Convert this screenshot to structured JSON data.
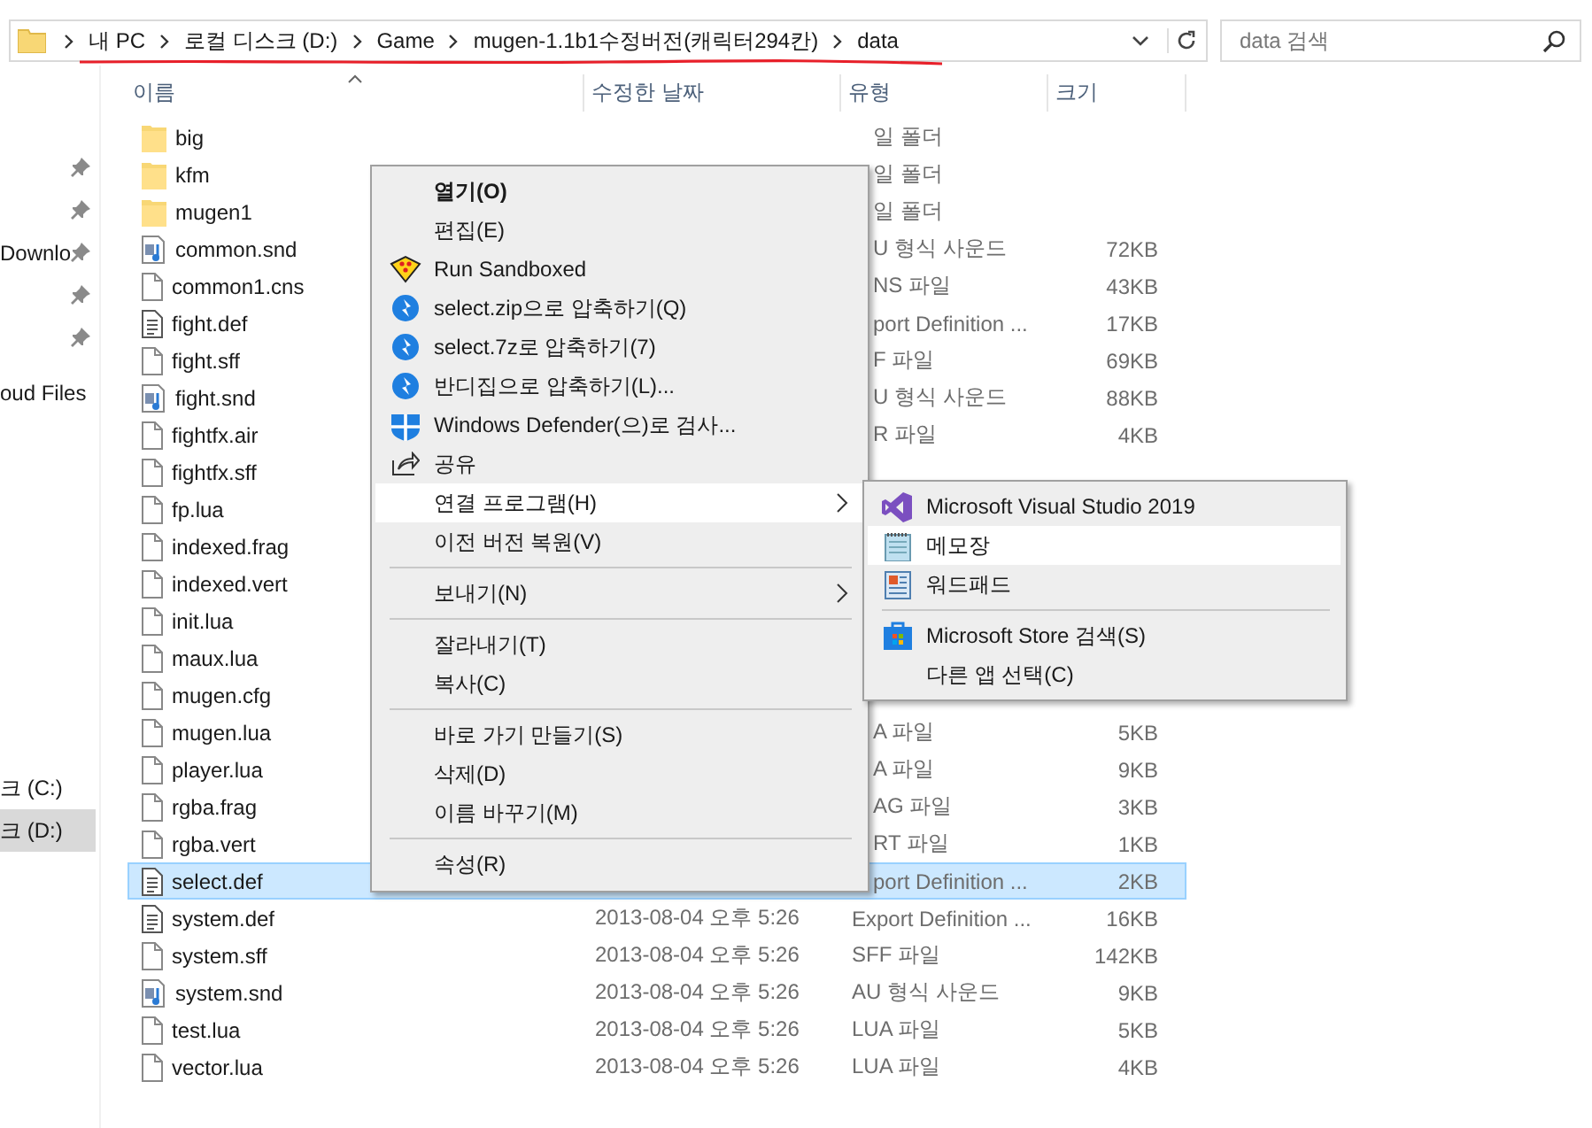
{
  "address_bar": {
    "crumbs": [
      "내 PC",
      "로컬 디스크 (D:)",
      "Game",
      "mugen-1.1b1수정버전(캐릭터294칸)",
      "data"
    ]
  },
  "search": {
    "placeholder": "data 검색"
  },
  "sidebar": {
    "sections": [
      {
        "items": [
          {
            "pinned": true,
            "selected": false
          },
          {
            "pinned": true,
            "selected": false
          },
          {
            "label": "Downlo",
            "pinned": true,
            "selected": false
          },
          {
            "pinned": true,
            "selected": false
          },
          {
            "pinned": true,
            "selected": false
          }
        ]
      },
      {
        "items": [
          {
            "label": "oud Files",
            "pinned": false,
            "selected": false
          }
        ]
      },
      {
        "items": [
          {
            "label": "크 (C:)",
            "pinned": false,
            "selected": false
          },
          {
            "label": "크 (D:)",
            "pinned": false,
            "selected": true
          }
        ]
      }
    ]
  },
  "columns": [
    "이름",
    "수정한 날짜",
    "유형",
    "크기"
  ],
  "files": [
    {
      "name": "big",
      "kind": "folder",
      "type": "일 폴더",
      "type_cut": true,
      "selected": false
    },
    {
      "name": "kfm",
      "kind": "folder",
      "type": "일 폴더",
      "type_cut": true,
      "selected": false
    },
    {
      "name": "mugen1",
      "kind": "folder",
      "type": "일 폴더",
      "type_cut": true,
      "selected": false
    },
    {
      "name": "common.snd",
      "kind": "audio",
      "type": "U 형식 사운드",
      "type_cut": true,
      "size": "72KB",
      "selected": false
    },
    {
      "name": "common1.cns",
      "kind": "file",
      "type": "NS 파일",
      "type_cut": true,
      "size": "43KB",
      "selected": false
    },
    {
      "name": "fight.def",
      "kind": "text",
      "type": "port Definition ...",
      "type_cut": true,
      "size": "17KB",
      "selected": false
    },
    {
      "name": "fight.sff",
      "kind": "file",
      "type": "F 파일",
      "type_cut": true,
      "size": "69KB",
      "selected": false
    },
    {
      "name": "fight.snd",
      "kind": "audio",
      "type": "U 형식 사운드",
      "type_cut": true,
      "size": "88KB",
      "selected": false
    },
    {
      "name": "fightfx.air",
      "kind": "file",
      "type": "R 파일",
      "type_cut": true,
      "size": "4KB",
      "selected": false
    },
    {
      "name": "fightfx.sff",
      "kind": "file",
      "selected": false
    },
    {
      "name": "fp.lua",
      "kind": "file",
      "selected": false
    },
    {
      "name": "indexed.frag",
      "kind": "file",
      "selected": false
    },
    {
      "name": "indexed.vert",
      "kind": "file",
      "selected": false
    },
    {
      "name": "init.lua",
      "kind": "file",
      "selected": false
    },
    {
      "name": "maux.lua",
      "kind": "file",
      "selected": false
    },
    {
      "name": "mugen.cfg",
      "kind": "file",
      "selected": false
    },
    {
      "name": "mugen.lua",
      "kind": "file",
      "type": "A 파일",
      "type_cut": true,
      "size": "5KB",
      "selected": false
    },
    {
      "name": "player.lua",
      "kind": "file",
      "type": "A 파일",
      "type_cut": true,
      "size": "9KB",
      "selected": false
    },
    {
      "name": "rgba.frag",
      "kind": "file",
      "type": "AG 파일",
      "type_cut": true,
      "size": "3KB",
      "selected": false
    },
    {
      "name": "rgba.vert",
      "kind": "file",
      "type": "RT 파일",
      "type_cut": true,
      "size": "1KB",
      "selected": false
    },
    {
      "name": "select.def",
      "kind": "text",
      "type": "port Definition ...",
      "type_cut": true,
      "size": "2KB",
      "selected": true
    },
    {
      "name": "system.def",
      "kind": "text",
      "date": "2013-08-04 오후 5:26",
      "type": "Export Definition ...",
      "type_cut": false,
      "size": "16KB",
      "selected": false
    },
    {
      "name": "system.sff",
      "kind": "file",
      "date": "2013-08-04 오후 5:26",
      "type": "SFF 파일",
      "type_cut": false,
      "size": "142KB",
      "selected": false
    },
    {
      "name": "system.snd",
      "kind": "audio",
      "date": "2013-08-04 오후 5:26",
      "type": "AU 형식 사운드",
      "type_cut": false,
      "size": "9KB",
      "selected": false
    },
    {
      "name": "test.lua",
      "kind": "file",
      "date": "2013-08-04 오후 5:26",
      "type": "LUA 파일",
      "type_cut": false,
      "size": "5KB",
      "selected": false
    },
    {
      "name": "vector.lua",
      "kind": "file",
      "date": "2013-08-04 오후 5:26",
      "type": "LUA 파일",
      "type_cut": false,
      "size": "4KB",
      "selected": false
    }
  ],
  "context_menu": {
    "items": [
      {
        "kind": "item",
        "label": "열기(O)",
        "bold": true,
        "selected": false
      },
      {
        "kind": "item",
        "label": "편집(E)",
        "bold": false,
        "selected": false
      },
      {
        "kind": "item",
        "label": "Run Sandboxed",
        "bold": false,
        "selected": false
      },
      {
        "kind": "item",
        "label": "select.zip으로 압축하기(Q)",
        "bold": false,
        "selected": false
      },
      {
        "kind": "item",
        "label": "select.7z로 압축하기(7)",
        "bold": false,
        "selected": false
      },
      {
        "kind": "item",
        "label": "반디집으로 압축하기(L)...",
        "bold": false,
        "selected": false
      },
      {
        "kind": "item",
        "label": "Windows Defender(으)로 검사...",
        "bold": false,
        "selected": false
      },
      {
        "kind": "item",
        "label": "공유",
        "bold": false,
        "selected": false
      },
      {
        "kind": "item",
        "label": "연결 프로그램(H)",
        "submenu": true,
        "bold": false,
        "selected": true
      },
      {
        "kind": "item",
        "label": "이전 버전 복원(V)",
        "bold": false,
        "selected": false
      },
      {
        "kind": "separator"
      },
      {
        "kind": "item",
        "label": "보내기(N)",
        "submenu": true,
        "bold": false,
        "selected": false
      },
      {
        "kind": "separator"
      },
      {
        "kind": "item",
        "label": "잘라내기(T)",
        "bold": false,
        "selected": false
      },
      {
        "kind": "item",
        "label": "복사(C)",
        "bold": false,
        "selected": false
      },
      {
        "kind": "separator"
      },
      {
        "kind": "item",
        "label": "바로 가기 만들기(S)",
        "bold": false,
        "selected": false
      },
      {
        "kind": "item",
        "label": "삭제(D)",
        "bold": false,
        "selected": false
      },
      {
        "kind": "item",
        "label": "이름 바꾸기(M)",
        "bold": false,
        "selected": false
      },
      {
        "kind": "separator"
      },
      {
        "kind": "item",
        "label": "속성(R)",
        "bold": false,
        "selected": false
      }
    ]
  },
  "submenu": {
    "items": [
      {
        "kind": "item",
        "label": "Microsoft Visual Studio 2019",
        "selected": false
      },
      {
        "kind": "item",
        "label": "메모장",
        "selected": true
      },
      {
        "kind": "item",
        "label": "워드패드",
        "selected": false
      },
      {
        "kind": "separator"
      },
      {
        "kind": "item",
        "label": "Microsoft Store 검색(S)",
        "selected": false
      },
      {
        "kind": "item",
        "label": "다른 앱 선택(C)",
        "selected": false
      }
    ]
  }
}
